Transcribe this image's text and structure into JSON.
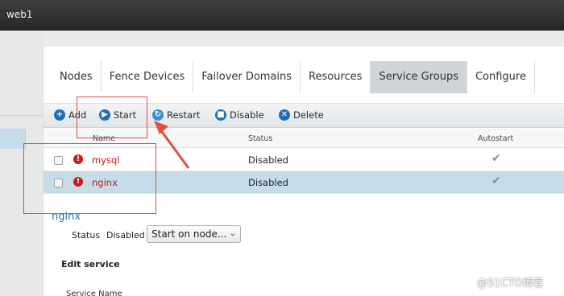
{
  "app": {
    "title": "web1"
  },
  "tabs": [
    {
      "label": "Nodes"
    },
    {
      "label": "Fence Devices"
    },
    {
      "label": "Failover Domains"
    },
    {
      "label": "Resources"
    },
    {
      "label": "Service Groups"
    },
    {
      "label": "Configure"
    }
  ],
  "toolbar": {
    "add_label": "Add",
    "start_label": "Start",
    "restart_label": "Restart",
    "disable_label": "Disable",
    "delete_label": "Delete"
  },
  "table": {
    "headers": [
      "Name",
      "Status",
      "Autostart"
    ],
    "rows": [
      {
        "name": "mysql",
        "status": "Disabled",
        "autostart": "✔"
      },
      {
        "name": "nginx",
        "status": "Disabled",
        "autostart": "✔"
      }
    ]
  },
  "detail": {
    "service_name": "nginx",
    "status_label": "Status",
    "status_value": "Disabled",
    "action_select": "Start on node...",
    "edit_title": "Edit  service",
    "field_label": "Service  Name"
  },
  "colors": {
    "accent": "#1d6fb8",
    "error": "#c0191b",
    "selected_row": "#c7dce9",
    "annotation": "#e44a4a"
  },
  "watermark": "@51CTO博客"
}
